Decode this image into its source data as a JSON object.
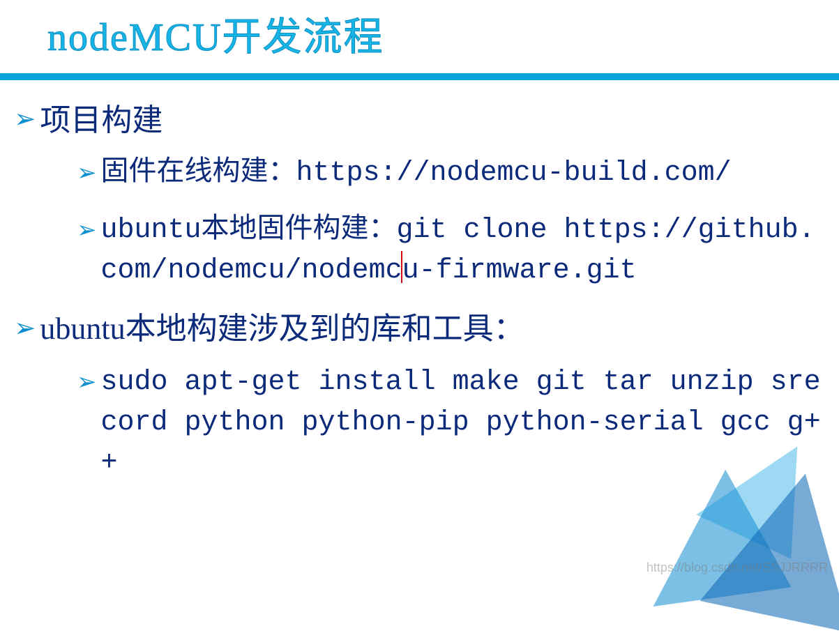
{
  "title": "nodeMCU开发流程",
  "bullets": {
    "l1_0": "项目构建",
    "l2_0": "固件在线构建：https://nodemcu-build.com/",
    "l2_1_a": "ubuntu本地固件构建：git clone https://github.com/nodemcu/nodemc",
    "l2_1_b": "u-firmware.git",
    "l1_1": "ubuntu本地构建涉及到的库和工具：",
    "l2_2": "sudo apt-get install make git tar unzip srecord python python-pip python-serial gcc g++"
  },
  "watermark": "https://blog.csdn.net/SSJJRRRR"
}
